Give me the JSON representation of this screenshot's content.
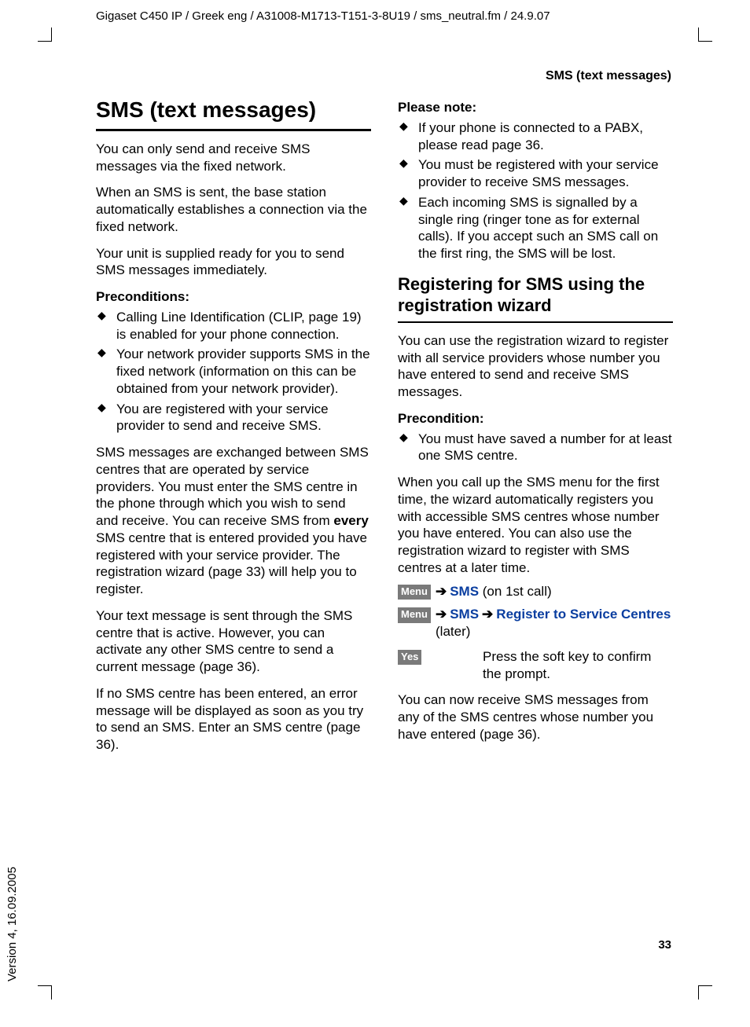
{
  "meta": {
    "header": "Gigaset C450 IP / Greek eng / A31008-M1713-T151-3-8U19 / sms_neutral.fm / 24.9.07",
    "version_side": "Version 4, 16.09.2005",
    "running_head": "SMS (text messages)",
    "page_number": "33"
  },
  "left": {
    "h1": "SMS (text messages)",
    "p1": "You can only send and receive SMS messages via the fixed network.",
    "p2": "When an SMS is sent, the base station automatically establishes a connection via the fixed network.",
    "p3": "Your unit is supplied ready for you to send SMS messages immediately.",
    "preconditions_head": "Preconditions:",
    "preconditions": [
      "Calling Line Identification (CLIP, page 19) is enabled for your phone connection.",
      "Your network provider supports SMS in the fixed network (information on this can be obtained from your network provider).",
      "You are registered with your service provider to send and receive SMS."
    ],
    "p4a": "SMS messages are exchanged between SMS centres that are operated by service providers. You must enter the SMS centre in the phone through which you wish to send and receive. You can receive SMS from ",
    "p4b_bold": "every",
    "p4c": " SMS centre that is entered provided you have registered with your service provider. The registration wizard (page 33) will help you to register.",
    "p5": "Your text message is sent through the SMS centre that is active. However, you can activate any other SMS centre to send a current message (page 36).",
    "p6": "If no SMS centre has been entered, an error message will be displayed as soon as you try to send an SMS. Enter an SMS centre (page 36)."
  },
  "right": {
    "please_note_head": "Please note:",
    "please_note": [
      "If your phone is connected to a PABX, please read page 36.",
      "You must be registered with your service provider to receive SMS messages.",
      "Each incoming SMS is signalled by a single ring (ringer tone as for external calls). If you accept such an SMS call on the first ring, the SMS will be lost."
    ],
    "h2": "Registering for SMS using the registration wizard",
    "p1": "You can use the registration wizard to register with all service providers whose number you have entered to send and receive SMS messages.",
    "precondition_head": "Precondition:",
    "precondition": [
      "You must have saved a number for at least one SMS centre."
    ],
    "p2": "When you call up the SMS menu for the first time, the wizard automatically registers you with accessible SMS centres whose number you have entered. You can also use the registration wizard to register with SMS centres at a later time.",
    "menu_label": "Menu",
    "sms_label": "SMS",
    "first_call_suffix": " (on 1st call)",
    "register_label": "Register to Service Centres",
    "later_suffix": "(later)",
    "yes_label": "Yes",
    "yes_desc": "Press the soft key to confirm the prompt.",
    "p3": "You can now receive SMS messages from any of the SMS centres whose number you have entered (page 36)."
  }
}
